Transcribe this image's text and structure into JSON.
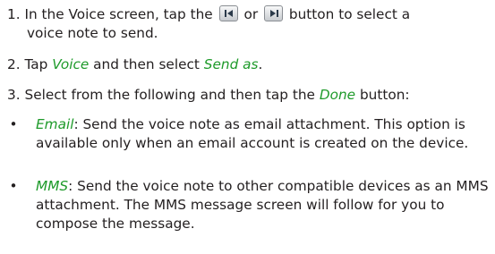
{
  "steps": [
    {
      "number": "1.",
      "text_before": "In the Voice screen, tap the",
      "connector": "or",
      "text_after": "button to select a",
      "continuation": "voice note to send.",
      "icons": [
        "previous-track-icon",
        "next-track-icon"
      ]
    },
    {
      "number": "2.",
      "text_before": "Tap",
      "link1": "Voice",
      "text_middle": "and then select",
      "link2": "Send as",
      "text_after": "."
    },
    {
      "number": "3.",
      "text_before": "Select from the following and then tap the",
      "link": "Done",
      "text_after": "button:"
    }
  ],
  "options": [
    {
      "bullet": "•",
      "term": "Email",
      "description": ": Send the voice note as email attachment. This option is available only when an email account is created on the device."
    },
    {
      "bullet": "•",
      "term": "MMS",
      "description": ": Send the voice note to other compatible devices as an MMS attachment. The MMS message screen will follow for you to compose the message."
    }
  ],
  "colors": {
    "text": "#231f20",
    "highlight": "#1e9a2a"
  }
}
